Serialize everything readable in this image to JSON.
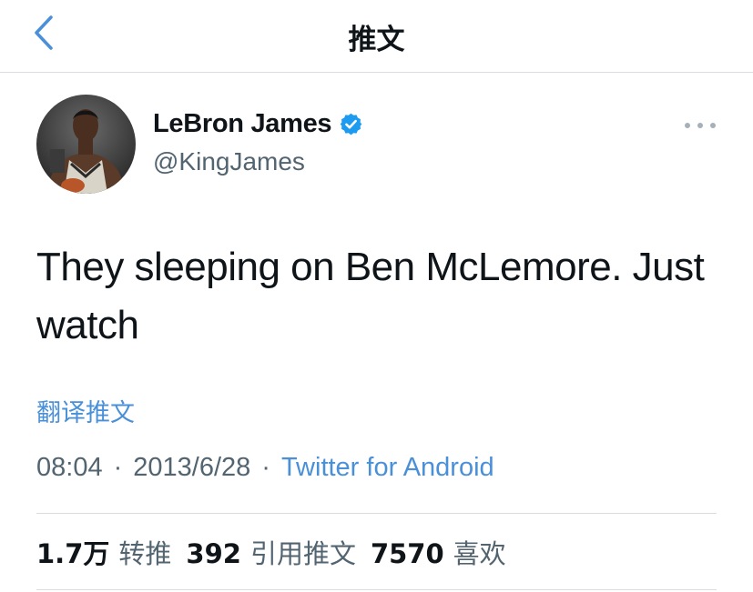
{
  "header": {
    "title": "推文",
    "back_icon": "chevron-left-icon"
  },
  "tweet": {
    "author_name": "LeBron James",
    "author_handle": "@KingJames",
    "verified_icon": "verified-badge-icon",
    "more_icon": "more-horizontal-icon",
    "text": "They sleeping on Ben McLemore. Just watch",
    "translate_label": "翻译推文",
    "time": "08:04",
    "date": "2013/6/28",
    "separator": "·",
    "client": "Twitter for Android"
  },
  "stats": {
    "retweets_count": "1.7万",
    "retweets_label": "转推",
    "quotes_count": "392",
    "quotes_label": "引用推文",
    "likes_count": "7570",
    "likes_label": "喜欢"
  },
  "colors": {
    "accent": "#4a90d9",
    "secondary_text": "#536471",
    "primary_text": "#0f1419",
    "divider": "#d9dde1",
    "verified": "#1d9bf0"
  }
}
